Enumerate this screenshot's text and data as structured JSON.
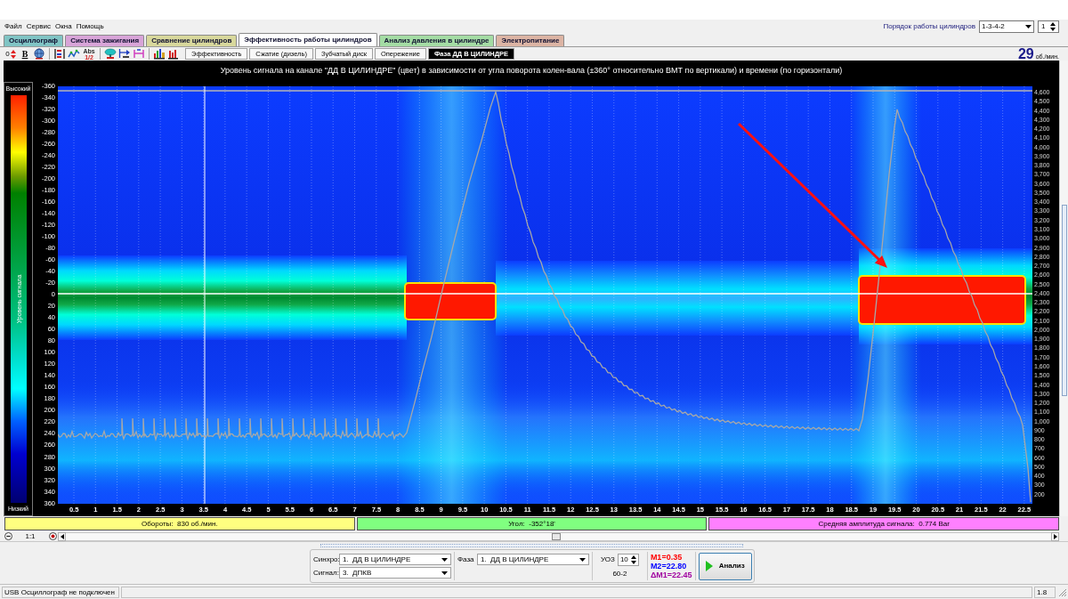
{
  "menu_bar": {
    "items": [
      "Файл",
      "Сервис",
      "Окна",
      "Помощь"
    ],
    "cylinder_order": {
      "label": "Порядок работы цилиндров",
      "value": "1-3-4-2",
      "spinner": "1"
    }
  },
  "tabs": [
    {
      "label": "Осциллограф",
      "selected": false,
      "color": "#80c4c4"
    },
    {
      "label": "Система зажигания",
      "selected": false,
      "color": "#d8a4d8"
    },
    {
      "label": "Сравнение цилиндров",
      "selected": false,
      "color": "#d8d89c"
    },
    {
      "label": "Эффективность работы цилиндров",
      "selected": true,
      "color": "#ffffff"
    },
    {
      "label": "Анализ давления в цилиндре",
      "selected": false,
      "color": "#a4dca4"
    },
    {
      "label": "Электропитание",
      "selected": false,
      "color": "#dcb4a4"
    }
  ],
  "toolbar": {
    "groups": [
      [
        {
          "kind": "arrows",
          "text": "0"
        },
        {
          "kind": "letter",
          "text": "B"
        },
        {
          "kind": "icon"
        }
      ],
      [
        {
          "kind": "icon"
        },
        {
          "kind": "icon"
        },
        {
          "kind": "stacked",
          "text": "Abs",
          "sub": "1/2"
        }
      ],
      [
        {
          "kind": "icon"
        },
        {
          "kind": "icon"
        },
        {
          "kind": "icon"
        }
      ],
      [
        {
          "kind": "icon"
        },
        {
          "kind": "icon"
        }
      ]
    ],
    "subtabs": [
      {
        "label": "Эффективность",
        "selected": false
      },
      {
        "label": "Сжатие (дизель)",
        "selected": false
      },
      {
        "label": "Зубчатый диск",
        "selected": false
      },
      {
        "label": "Опережение",
        "selected": false
      },
      {
        "label": "Фаза ДД В ЦИЛИНДРЕ",
        "selected": true
      }
    ],
    "rpm": {
      "value": "29",
      "unit": "об./мин."
    }
  },
  "chart": {
    "title": "Уровень сигнала на канале \"ДД В ЦИЛИНДРЕ\" (цвет) в зависимости от угла поворота колен-вала (±360° относительно ВМТ по вертикали) и времени (по горизонтали)",
    "legend": {
      "high": "Высокий",
      "title": "Уровень сигнала",
      "low": "Низкий"
    },
    "y_left_ticks": [
      "-360",
      "-340",
      "-320",
      "-300",
      "-280",
      "-260",
      "-240",
      "-220",
      "-200",
      "-180",
      "-160",
      "-140",
      "-120",
      "-100",
      "-80",
      "-60",
      "-40",
      "-20",
      "0",
      "20",
      "40",
      "60",
      "80",
      "100",
      "120",
      "140",
      "160",
      "180",
      "200",
      "220",
      "240",
      "260",
      "280",
      "300",
      "320",
      "340",
      "360"
    ],
    "y_right_ticks": [
      "4,600",
      "4,500",
      "4,400",
      "4,300",
      "4,200",
      "4,100",
      "4,000",
      "3,900",
      "3,800",
      "3,700",
      "3,600",
      "3,500",
      "3,400",
      "3,300",
      "3,200",
      "3,100",
      "3,000",
      "2,900",
      "2,800",
      "2,700",
      "2,600",
      "2,500",
      "2,400",
      "2,300",
      "2,200",
      "2,100",
      "2,000",
      "1,900",
      "1,800",
      "1,700",
      "1,600",
      "1,500",
      "1,400",
      "1,300",
      "1,200",
      "1,100",
      "1,000",
      "900",
      "800",
      "700",
      "600",
      "500",
      "400",
      "300",
      "200"
    ],
    "x_ticks": [
      "0.5",
      "1",
      "1.5",
      "2",
      "2.5",
      "3",
      "3.5",
      "4",
      "4.5",
      "5",
      "5.5",
      "6",
      "6.5",
      "7",
      "7.5",
      "8",
      "8.5",
      "9",
      "9.5",
      "10",
      "10.5",
      "11",
      "11.5",
      "12",
      "12.5",
      "13",
      "13.5",
      "14",
      "14.5",
      "15",
      "15.5",
      "16",
      "16.5",
      "17",
      "17.5",
      "18",
      "18.5",
      "19",
      "19.5",
      "20",
      "20.5",
      "21",
      "21.5",
      "22",
      "22.5"
    ]
  },
  "readouts": [
    {
      "text": "Обороты:  830 об./мин.",
      "color": "#ffff80"
    },
    {
      "text": "Угол:  -352°18'",
      "color": "#80ff80"
    },
    {
      "text": "Средняя амплитуда сигнала:  0.774 Bar",
      "color": "#ff80ff"
    }
  ],
  "zoom": {
    "ratio": "1:1"
  },
  "controls": {
    "sync": {
      "label": "Синхро:",
      "value": "1.  ДД В ЦИЛИНДРЕ"
    },
    "signal": {
      "label": "Сигнал:",
      "value": "3.  ДПКВ"
    },
    "phase": {
      "label": "Фаза",
      "value": "1.  ДД В ЦИЛИНДРЕ"
    },
    "uoz": {
      "label": "УОЗ",
      "value": "10",
      "wheel": "60-2"
    },
    "markers": [
      {
        "text": "M1=0.35",
        "color": "#ff0000"
      },
      {
        "text": "M2=22.80",
        "color": "#0000ff"
      },
      {
        "text": "ΔM1=22.45",
        "color": "#a000a0"
      }
    ],
    "analyze_button": "Анализ"
  },
  "status_bar": {
    "connection": "USB Осциллограф не подключен",
    "version": "1.8"
  }
}
